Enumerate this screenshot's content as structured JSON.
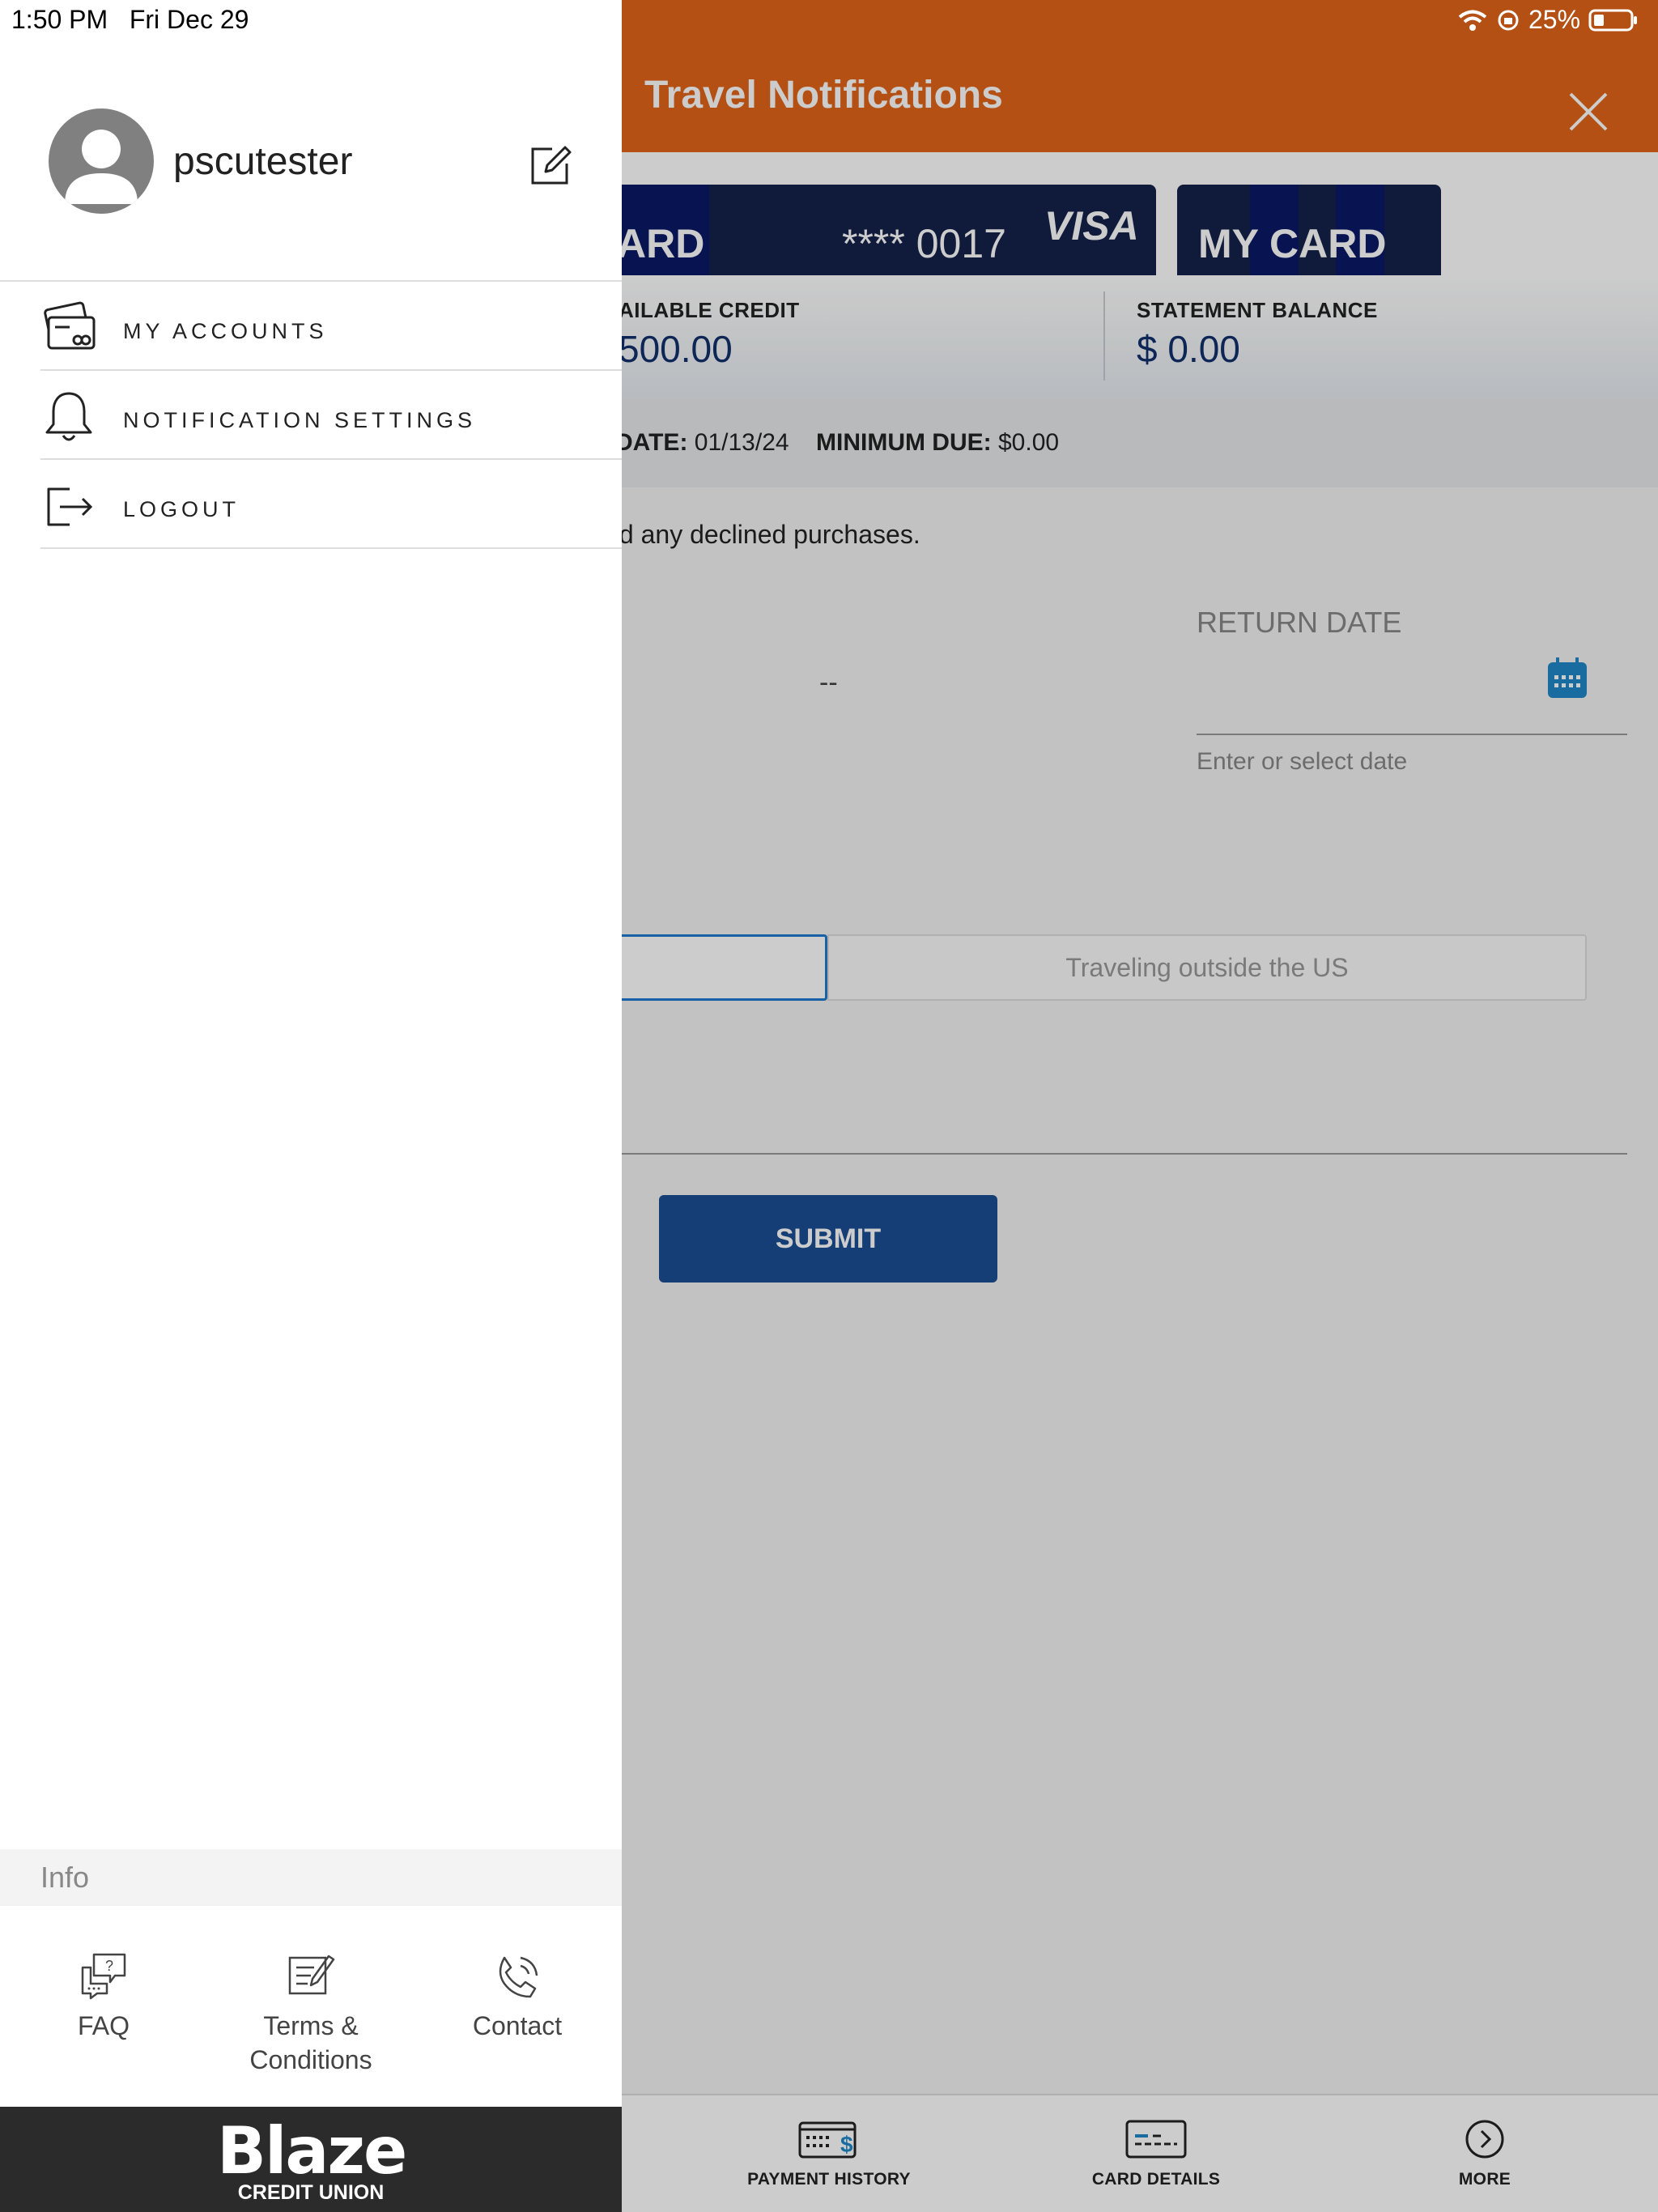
{
  "status_bar": {
    "time": "1:50 PM",
    "date": "Fri Dec 29",
    "battery": "25%"
  },
  "app": {
    "title": "Travel Notifications",
    "cards": [
      {
        "partial_name": "ARD",
        "masked_number": "**** 0017",
        "network": "VISA"
      },
      {
        "name": "MY CARD"
      }
    ],
    "balances": {
      "available_label": "AILABLE CREDIT",
      "available_value": "500.00",
      "statement_label": "STATEMENT BALANCE",
      "statement_value": "$ 0.00"
    },
    "due": {
      "date_label": "DATE:",
      "date_value": "01/13/24",
      "min_label": "MINIMUM DUE:",
      "min_value": "$0.00"
    },
    "info_text": "oid any declined purchases.",
    "departure_placeholder": "--",
    "return_label": "RETURN DATE",
    "return_hint": "Enter or select date",
    "segment_right": "Traveling outside the US",
    "submit_label": "SUBMIT",
    "nav": [
      {
        "label": "PAYMENT HISTORY",
        "icon": "payment-history-icon"
      },
      {
        "label": "CARD DETAILS",
        "icon": "card-details-icon"
      },
      {
        "label": "MORE",
        "icon": "more-icon"
      }
    ],
    "colors": {
      "header": "#e2641a",
      "navy": "#14224b",
      "submit": "#1c4e94",
      "calendar": "#1e88c9"
    }
  },
  "drawer": {
    "username": "pscutester",
    "menu": [
      {
        "label": "MY ACCOUNTS",
        "icon": "accounts-cards-icon"
      },
      {
        "label": "NOTIFICATION SETTINGS",
        "icon": "bell-icon"
      },
      {
        "label": "LOGOUT",
        "icon": "logout-icon"
      }
    ],
    "info_title": "Info",
    "info_links": [
      {
        "label": "FAQ",
        "icon": "faq-icon"
      },
      {
        "label": "Terms & Conditions",
        "icon": "terms-icon"
      },
      {
        "label": "Contact",
        "icon": "phone-icon"
      }
    ],
    "logo": {
      "word": "Blaze",
      "sub": "CREDIT UNION"
    }
  }
}
